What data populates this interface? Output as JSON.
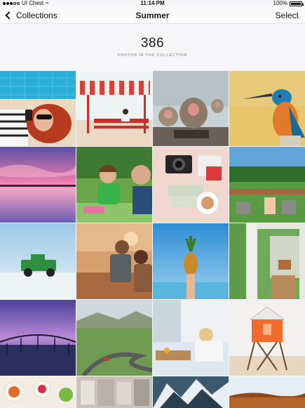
{
  "status_bar": {
    "carrier": "UI Chest",
    "time": "11:14 PM",
    "battery": "100%"
  },
  "nav": {
    "back_label": "Collections",
    "title": "Summer",
    "select_label": "Select"
  },
  "collection": {
    "count": "386",
    "count_label": "PHOTOS IN THE COLLECTION"
  },
  "photos": [
    "pool-sunglasses-woman",
    "beach-bench-awning",
    "snow-monkeys",
    "kingfisher",
    "sunset-lake",
    "children-on-grass",
    "camera-travel-flatlay",
    "park-chairs",
    "green-truck-salt-flat",
    "couple-hillside",
    "hand-holding-pineapple",
    "open-door-patio",
    "pier-dusk",
    "mountain-road",
    "breakfast-in-bed",
    "lifeguard-tower",
    "fruit-bowls",
    "city-buildings-aerial",
    "snowy-mountains",
    "autumn-field"
  ]
}
